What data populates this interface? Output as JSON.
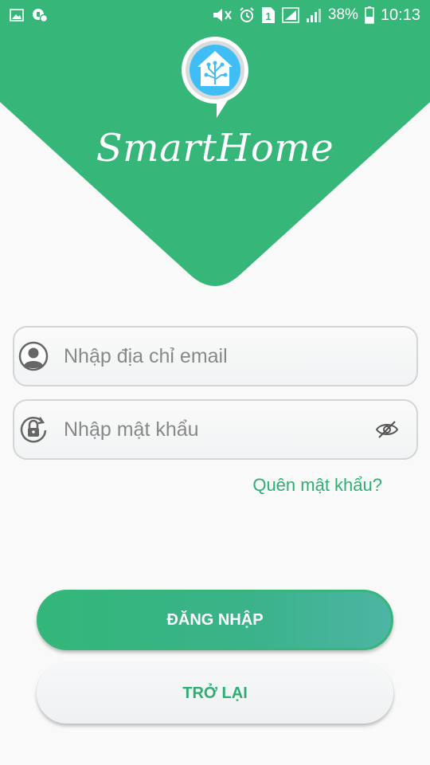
{
  "status_bar": {
    "battery_percent": "38%",
    "time": "10:13",
    "sim_label": "1",
    "left_icons": [
      "image-icon",
      "gamepad-icon"
    ],
    "right_icons": [
      "mute-icon",
      "alarm-icon",
      "sim-icon",
      "signal-icon",
      "signal-icon-2",
      "battery-icon"
    ]
  },
  "header": {
    "app_title": "SmartHome",
    "logo_icon": "home-assistant-logo-icon",
    "brand_color": "#37b679"
  },
  "form": {
    "email_placeholder": "Nhập địa chỉ email",
    "email_value": "",
    "password_placeholder": "Nhập mật khẩu",
    "password_value": "",
    "forgot_label": "Quên mật khẩu?"
  },
  "actions": {
    "login_label": "ĐĂNG NHẬP",
    "back_label": "TRỞ LẠI"
  }
}
